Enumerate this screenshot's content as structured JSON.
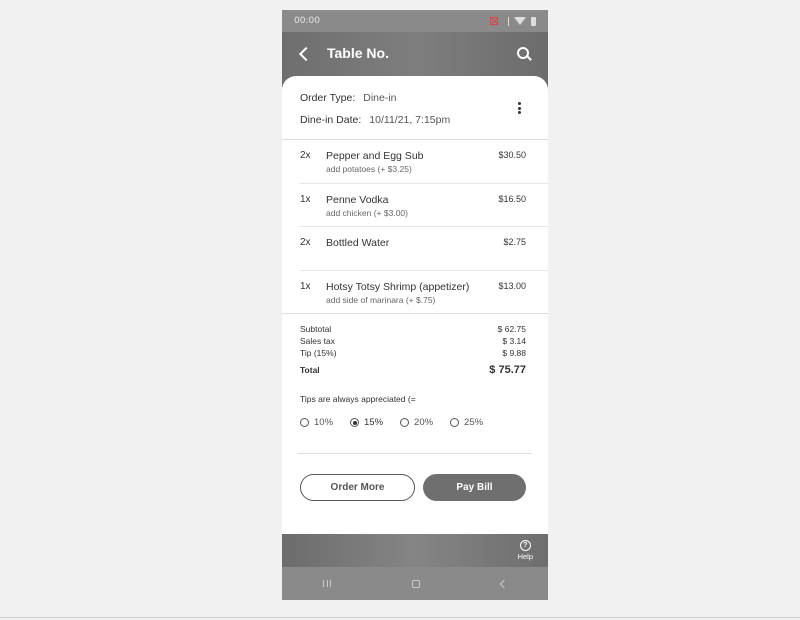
{
  "status_bar": {
    "time": "00:00"
  },
  "header": {
    "title": "Table No."
  },
  "order": {
    "type_label": "Order Type:",
    "type_value": "Dine-in",
    "date_label": "Dine-in Date:",
    "date_value": "10/11/21, 7:15pm"
  },
  "items": [
    {
      "qty": "2x",
      "name": "Pepper and Egg Sub",
      "modifier": "add potatoes (+ $3.25)",
      "price": "$30.50"
    },
    {
      "qty": "1x",
      "name": "Penne Vodka",
      "modifier": "add chicken (+ $3.00)",
      "price": "$16.50"
    },
    {
      "qty": "2x",
      "name": "Bottled Water",
      "modifier": "",
      "price": "$2.75"
    },
    {
      "qty": "1x",
      "name": "Hotsy Totsy Shrimp (appetizer)",
      "modifier": "add side of marinara (+ $.75)",
      "price": "$13.00"
    }
  ],
  "totals": {
    "subtotal_label": "Subtotal",
    "subtotal_value": "$ 62.75",
    "tax_label": "Sales tax",
    "tax_value": "$ 3.14",
    "tip_label": "Tip (15%)",
    "tip_value": "$ 9.88",
    "total_label": "Total",
    "total_value": "$ 75.77"
  },
  "tips": {
    "message": "Tips are always appreciated   (=",
    "options": [
      {
        "label": "10%",
        "selected": false
      },
      {
        "label": "15%",
        "selected": true
      },
      {
        "label": "20%",
        "selected": false
      },
      {
        "label": "25%",
        "selected": false
      }
    ]
  },
  "actions": {
    "order_more": "Order More",
    "pay_bill": "Pay Bill"
  },
  "footer": {
    "help_label": "Help",
    "help_glyph": "?"
  },
  "icons": {
    "back": "back-arrow-icon",
    "search": "search-icon",
    "more": "more-vert-icon",
    "help": "help-circle-icon"
  },
  "colors": {
    "header": "#7a7a7a",
    "pay_button": "#6f6f6f",
    "background": "#f1f1f1"
  }
}
